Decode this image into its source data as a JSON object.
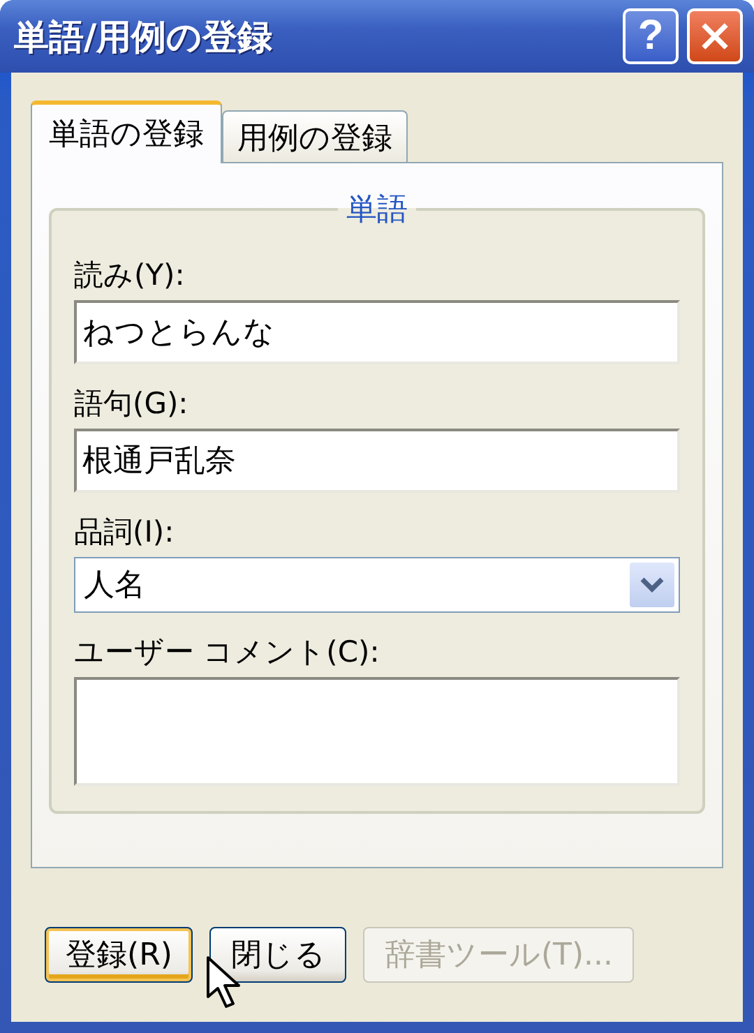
{
  "window": {
    "title": "単語/用例の登録",
    "help_button": "?"
  },
  "tabs": [
    {
      "label": "単語の登録",
      "selected": true
    },
    {
      "label": "用例の登録",
      "selected": false
    }
  ],
  "group": {
    "legend": "単語",
    "fields": [
      {
        "kind": "text",
        "label": "読み(Y):",
        "value": "ねつとらんな"
      },
      {
        "kind": "text",
        "label": "語句(G):",
        "value": "根通戸乱奈"
      },
      {
        "kind": "combo",
        "label": "品詞(I):",
        "value": "人名"
      },
      {
        "kind": "textarea",
        "label": "ユーザー コメント(C):"
      }
    ]
  },
  "buttons": [
    {
      "label": "登録(R)",
      "default": true,
      "disabled": false
    },
    {
      "label": "閉じる",
      "default": false,
      "disabled": false
    },
    {
      "label": "辞書ツール(T)...",
      "default": false,
      "disabled": true
    }
  ]
}
